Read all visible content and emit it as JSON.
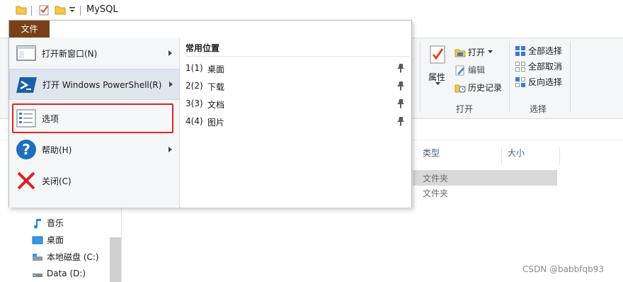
{
  "window": {
    "title": "MySQL"
  },
  "ribbon": {
    "file_tab": "文件",
    "properties_label": "属性",
    "open_label": "打开",
    "edit_label": "编辑",
    "history_label": "历史记录",
    "open_group_label": "打开",
    "select_all": "全部选择",
    "select_none": "全部取消",
    "invert_select": "反向选择",
    "select_group_label": "选择"
  },
  "content": {
    "columns": [
      "类型",
      "大小"
    ],
    "rows": [
      {
        "type": "文件夹"
      },
      {
        "type": "文件夹"
      }
    ]
  },
  "nav": {
    "items": [
      {
        "label": "音乐",
        "icon": "music-icon"
      },
      {
        "label": "桌面",
        "icon": "desktop-icon"
      },
      {
        "label": "本地磁盘 (C:)",
        "icon": "drive-icon"
      },
      {
        "label": "Data (D:)",
        "icon": "drive-icon"
      }
    ]
  },
  "file_menu": {
    "tab": "文件",
    "items": [
      {
        "label": "打开新窗口(N)",
        "icon": "new-window-icon",
        "has_submenu": true
      },
      {
        "label": "打开 Windows PowerShell(R)",
        "icon": "powershell-icon",
        "has_submenu": true
      },
      {
        "label": "选项",
        "icon": "options-icon",
        "has_submenu": false
      },
      {
        "label": "帮助(H)",
        "icon": "help-icon",
        "has_submenu": true
      },
      {
        "label": "关闭(C)",
        "icon": "close-icon",
        "has_submenu": false
      }
    ],
    "recent_title": "常用位置",
    "recent": [
      {
        "num": "1(1)",
        "name": "桌面"
      },
      {
        "num": "2(2)",
        "name": "下载"
      },
      {
        "num": "3(3)",
        "name": "文档"
      },
      {
        "num": "4(4)",
        "name": "图片"
      }
    ]
  },
  "watermark": "CSDN @babbfqb93",
  "colors": {
    "file_tab": "#7a4118",
    "highlight": "#e02424",
    "accent": "#1e6fbf"
  }
}
